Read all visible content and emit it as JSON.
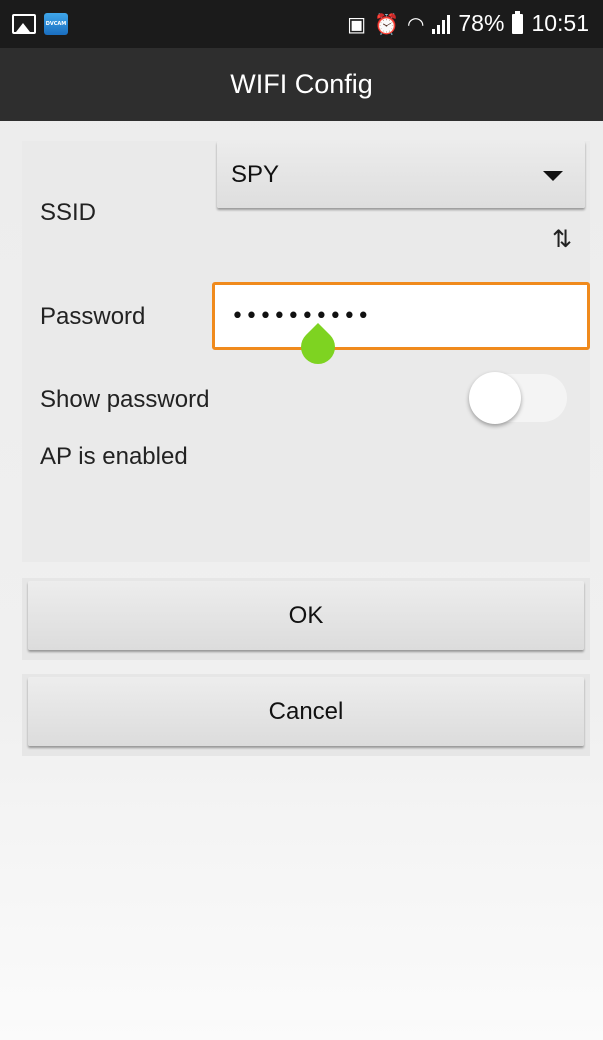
{
  "status_bar": {
    "app_icon_text": "DVCAM",
    "battery": "78%",
    "time": "10:51"
  },
  "appbar": {
    "title": "WIFI Config"
  },
  "form": {
    "ssid_label": "SSID",
    "ssid_value": "SPY",
    "password_label": "Password",
    "password_mask": "••••••••••",
    "show_password_label": "Show password",
    "show_password_on": false,
    "ap_status": "AP is enabled"
  },
  "buttons": {
    "ok": "OK",
    "cancel": "Cancel"
  },
  "colors": {
    "field_focus": "#f08a1c",
    "cursor_handle": "#7ed321",
    "appbar": "#2e2e2e"
  }
}
